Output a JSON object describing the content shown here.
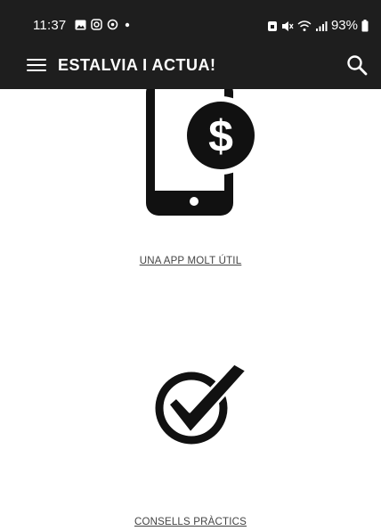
{
  "statusbar": {
    "time": "11:37",
    "battery": "93%",
    "left_icons": [
      "gallery-icon",
      "instagram-icon",
      "sync-icon",
      "dot-icon"
    ],
    "right_icons": [
      "alarm-icon",
      "mute-icon",
      "wifi-icon",
      "signal-icon",
      "battery-icon"
    ]
  },
  "appbar": {
    "title": "ESTALVIA I ACTUA!",
    "menu_icon": "hamburger-menu-icon",
    "search_icon": "search-icon"
  },
  "content": {
    "item1": {
      "icon": "phone-dollar-icon",
      "label": "UNA APP MOLT ÚTIL"
    },
    "item2": {
      "icon": "checkmark-circle-icon",
      "label": "CONSELLS PRÀCTICS"
    }
  },
  "colors": {
    "bar_background": "#1e1e1e",
    "bar_text": "#ffffff",
    "link_text": "#444444",
    "icon_fill": "#111111"
  }
}
